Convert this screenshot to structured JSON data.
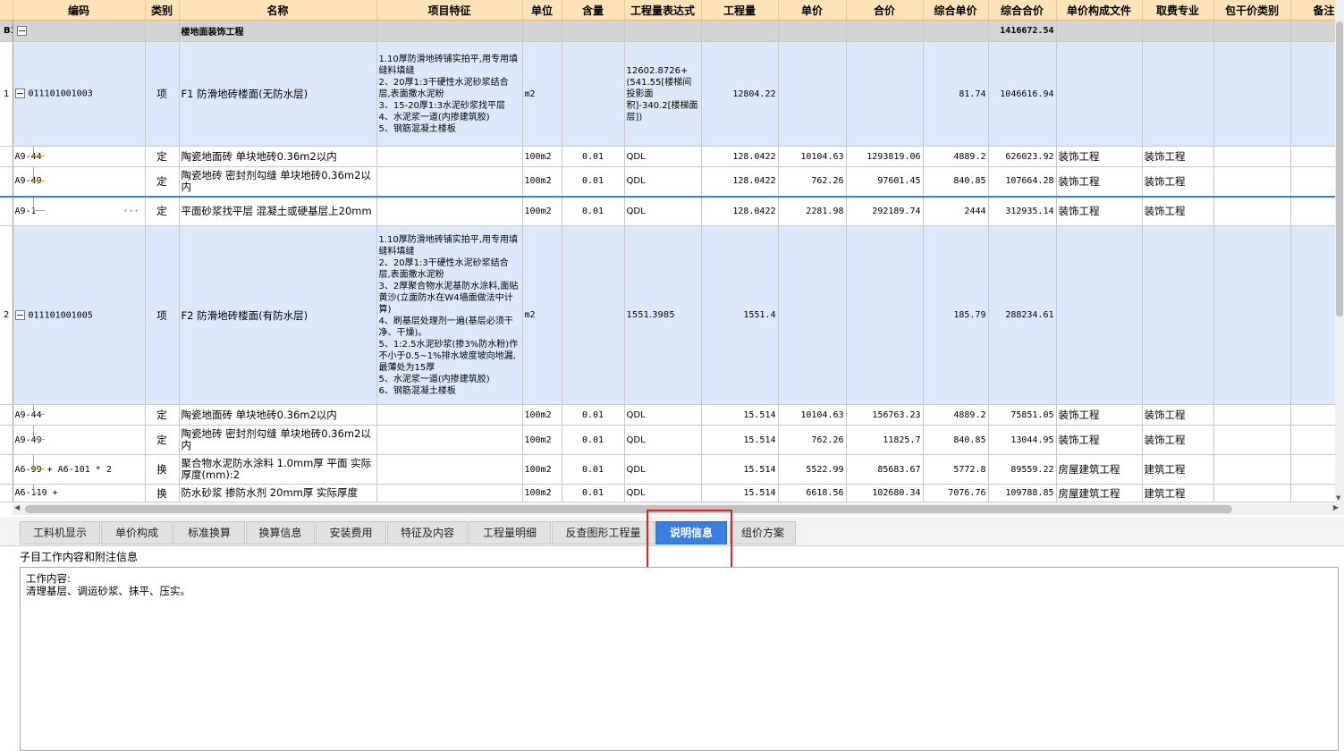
{
  "columns": [
    "",
    "编码",
    "类别",
    "名称",
    "项目特征",
    "单位",
    "含量",
    "工程量表达式",
    "工程量",
    "单价",
    "合价",
    "综合单价",
    "综合合价",
    "单价构成文件",
    "取费专业",
    "包干价类别",
    "备注"
  ],
  "section": {
    "id": "B1",
    "name": "楼地面装饰工程",
    "total": "1416672.54"
  },
  "rows": [
    {
      "kind": "qd",
      "num": "1",
      "code": "011101001003",
      "type": "项",
      "name": "F1 防滑地砖楼面(无防水层)",
      "feature": "1.10厚防滑地砖铺实拍平,用专用填缝料填缝\n2、20厚1:3干硬性水泥砂浆结合层,表面撒水泥粉\n3、15-20厚1:3水泥砂浆找平层\n4、水泥浆一道(内掺建筑胶)\n5、钢筋混凝土楼板",
      "unit": "m2",
      "content": "",
      "expr": "12602.8726+(541.55[楼梯间投影面积]-340.2[楼梯面层])",
      "qty": "12804.22",
      "price": "",
      "total": "",
      "comp_price": "81.74",
      "comp_total": "1046616.94",
      "file": "",
      "spec": "",
      "pkg": "",
      "note": ""
    },
    {
      "kind": "de",
      "num": "",
      "code": "A9-44",
      "type": "定",
      "name": "陶瓷地面砖 单块地砖0.36m2以内",
      "feature": "",
      "unit": "100m2",
      "content": "0.01",
      "expr": "QDL",
      "qty": "128.0422",
      "price": "10104.63",
      "total": "1293819.06",
      "comp_price": "4889.2",
      "comp_total": "626023.92",
      "file": "装饰工程",
      "spec": "装饰工程",
      "pkg": "",
      "note": ""
    },
    {
      "kind": "de",
      "num": "",
      "code": "A9-49",
      "type": "定",
      "name": "陶瓷地砖 密封剂勾缝 单块地砖0.36m2以内",
      "feature": "",
      "unit": "100m2",
      "content": "0.01",
      "expr": "QDL",
      "qty": "128.0422",
      "price": "762.26",
      "total": "97601.45",
      "comp_price": "840.85",
      "comp_total": "107664.28",
      "file": "装饰工程",
      "spec": "装饰工程",
      "pkg": "",
      "note": ""
    },
    {
      "kind": "sel",
      "num": "",
      "code": "A9-1",
      "type": "定",
      "name": "平面砂浆找平层 混凝土或硬基层上20mm",
      "feature": "",
      "unit": "100m2",
      "content": "0.01",
      "expr": "QDL",
      "qty": "128.0422",
      "price": "2281.98",
      "total": "292189.74",
      "comp_price": "2444",
      "comp_total": "312935.14",
      "file": "装饰工程",
      "spec": "装饰工程",
      "pkg": "",
      "note": "",
      "dots": "···"
    },
    {
      "kind": "qd",
      "num": "2",
      "code": "011101001005",
      "type": "项",
      "name": "F2 防滑地砖楼面(有防水层)",
      "feature": "1.10厚防滑地砖铺实拍平,用专用填缝料填缝\n2、20厚1:3干硬性水泥砂浆结合层,表面撒水泥粉\n3、2厚聚合物水泥基防水涂料,面贴黄沙(立面防水在W4墙面做法中计算)\n4、刷基层处理剂一遍(基层必须干净、干燥)。\n5、1:2.5水泥砂浆(掺3%防水粉)作不小于0.5~1%排水坡度坡向地漏,最薄处为15厚\n5、水泥浆一道(内掺建筑胶)\n6、钢筋混凝土楼板",
      "unit": "m2",
      "content": "",
      "expr": "1551.3985",
      "qty": "1551.4",
      "price": "",
      "total": "",
      "comp_price": "185.79",
      "comp_total": "288234.61",
      "file": "",
      "spec": "",
      "pkg": "",
      "note": ""
    },
    {
      "kind": "de",
      "num": "",
      "code": "A9-44",
      "type": "定",
      "name": "陶瓷地面砖 单块地砖0.36m2以内",
      "feature": "",
      "unit": "100m2",
      "content": "0.01",
      "expr": "QDL",
      "qty": "15.514",
      "price": "10104.63",
      "total": "156763.23",
      "comp_price": "4889.2",
      "comp_total": "75851.05",
      "file": "装饰工程",
      "spec": "装饰工程",
      "pkg": "",
      "note": ""
    },
    {
      "kind": "de",
      "num": "",
      "code": "A9-49",
      "type": "定",
      "name": "陶瓷地砖 密封剂勾缝 单块地砖0.36m2以内",
      "feature": "",
      "unit": "100m2",
      "content": "0.01",
      "expr": "QDL",
      "qty": "15.514",
      "price": "762.26",
      "total": "11825.7",
      "comp_price": "840.85",
      "comp_total": "13044.95",
      "file": "装饰工程",
      "spec": "装饰工程",
      "pkg": "",
      "note": ""
    },
    {
      "kind": "de",
      "num": "",
      "code": "A6-99 + A6-101 * 2",
      "type": "换",
      "name": "聚合物水泥防水涂料 1.0mm厚 平面  实际厚度(mm):2",
      "feature": "",
      "unit": "100m2",
      "content": "0.01",
      "expr": "QDL",
      "qty": "15.514",
      "price": "5522.99",
      "total": "85683.67",
      "comp_price": "5772.8",
      "comp_total": "89559.22",
      "file": "房屋建筑工程",
      "spec": "建筑工程",
      "pkg": "",
      "note": ""
    },
    {
      "kind": "de",
      "num": "",
      "code": "A6-119 +",
      "type": "换",
      "name": "防水砂浆 掺防水剂 20mm厚  实际厚度",
      "feature": "",
      "unit": "100m2",
      "content": "0.01",
      "expr": "QDL",
      "qty": "15.514",
      "price": "6618.56",
      "total": "102680.34",
      "comp_price": "7076.76",
      "comp_total": "109788.85",
      "file": "房屋建筑工程",
      "spec": "建筑工程",
      "pkg": "",
      "note": ""
    }
  ],
  "tabs": [
    "工料机显示",
    "单价构成",
    "标准换算",
    "换算信息",
    "安装费用",
    "特征及内容",
    "工程量明细",
    "反查图形工程量",
    "说明信息",
    "组价方案"
  ],
  "active_tab": "说明信息",
  "panel": {
    "label": "子目工作内容和附注信息",
    "text": "工作内容:\n清理基层、调运砂浆、抹平、压实。"
  },
  "colors": {
    "header_bg": "#fde3b7",
    "qd_row_bg": "#dde9fb",
    "section_bg": "#d4d4d4",
    "active_tab": "#3a7fe0",
    "highlight": "#e02020"
  }
}
